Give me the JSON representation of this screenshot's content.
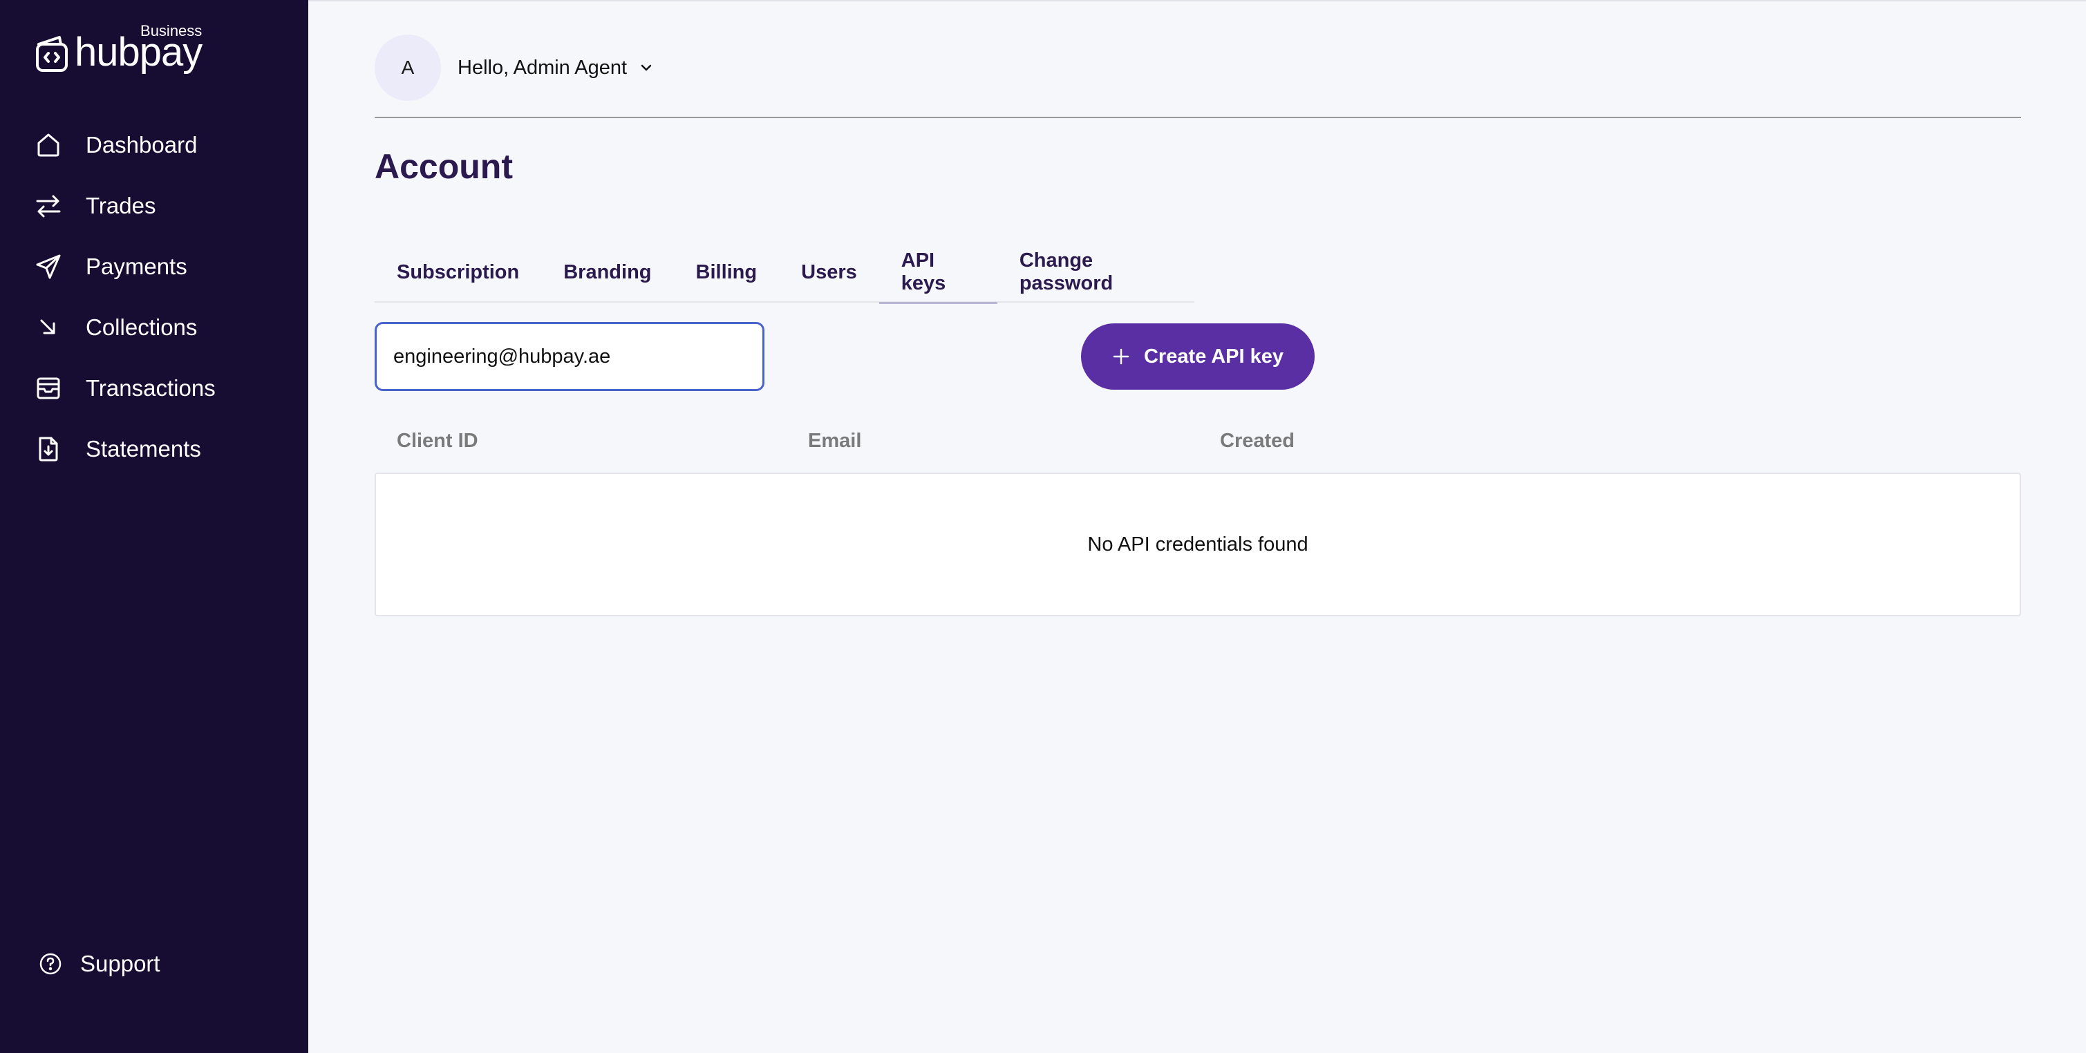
{
  "brand": {
    "name": "hubpay",
    "tag": "Business"
  },
  "sidebar": {
    "items": [
      {
        "label": "Dashboard",
        "icon": "home-icon"
      },
      {
        "label": "Trades",
        "icon": "swap-arrows-icon"
      },
      {
        "label": "Payments",
        "icon": "send-icon"
      },
      {
        "label": "Collections",
        "icon": "arrow-down-right-icon"
      },
      {
        "label": "Transactions",
        "icon": "inbox-icon"
      },
      {
        "label": "Statements",
        "icon": "file-download-icon"
      }
    ],
    "support": {
      "label": "Support",
      "icon": "help-circle-icon"
    }
  },
  "header": {
    "avatar_initial": "A",
    "greeting": "Hello, Admin Agent"
  },
  "main": {
    "title": "Account",
    "tabs": [
      {
        "label": "Subscription"
      },
      {
        "label": "Branding"
      },
      {
        "label": "Billing"
      },
      {
        "label": "Users"
      },
      {
        "label": "API keys",
        "active": true
      },
      {
        "label": "Change password"
      }
    ],
    "email_input": {
      "value": "engineering@hubpay.ae"
    },
    "create_button": "Create API key",
    "table": {
      "columns": [
        "Client ID",
        "Email",
        "Created"
      ],
      "empty_message": "No API credentials found"
    }
  },
  "colors": {
    "sidebar_bg": "#170c31",
    "accent": "#5a2fa3",
    "title": "#2b1a4e",
    "page_bg": "#f6f7fb"
  }
}
